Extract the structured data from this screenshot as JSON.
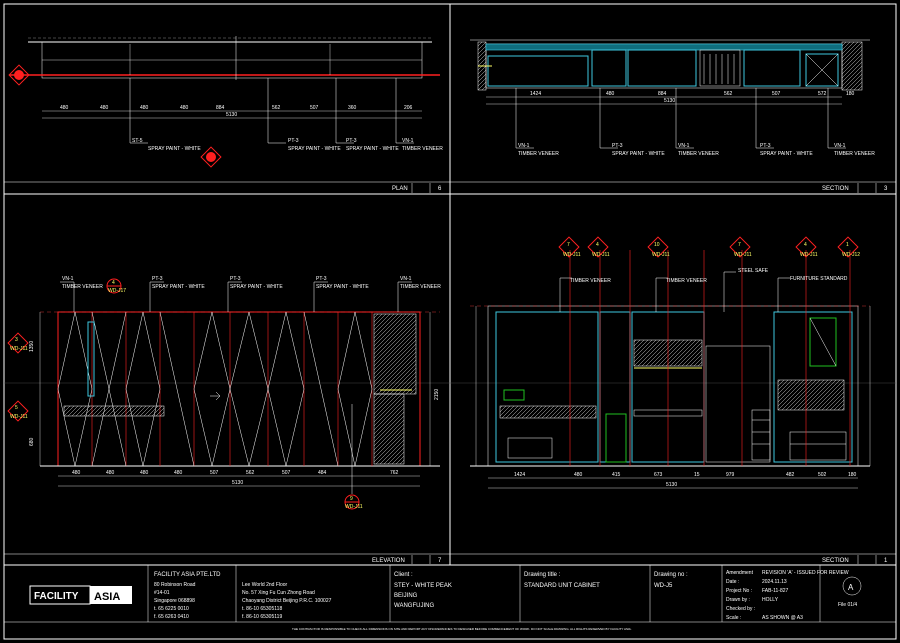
{
  "views": {
    "plan": {
      "label": "PLAN",
      "num": "6"
    },
    "section_top": {
      "label": "SECTION",
      "num": "3"
    },
    "elevation": {
      "label": "ELEVATION",
      "num": "7"
    },
    "section_bottom": {
      "label": "SECTION",
      "num": "1"
    }
  },
  "plan": {
    "dims": [
      "480",
      "480",
      "480",
      "480",
      "884",
      "562",
      "507",
      "360",
      "206"
    ],
    "total": "5130",
    "tags": [
      "ST-5",
      "PT-3",
      "PT-3",
      "VN-1"
    ],
    "notes": [
      "SPRAY PAINT - WHITE",
      "SPRAY PAINT - WHITE",
      "SPRAY PAINT - WHITE",
      "TIMBER VENEER"
    ]
  },
  "section_top": {
    "dims": [
      "1424",
      "480",
      "884",
      "562",
      "507",
      "572",
      "180"
    ],
    "total": "5130",
    "tags": [
      "VN-1",
      "PT-3",
      "VN-1",
      "PT-3",
      "VN-1"
    ],
    "notes": [
      "TIMBER VENEER",
      "SPRAY PAINT - WHITE",
      "TIMBER VENEER",
      "SPRAY PAINT - WHITE",
      "TIMBER VENEER"
    ]
  },
  "elevation": {
    "dims": [
      "480",
      "480",
      "480",
      "480",
      "507",
      "562",
      "507",
      "484",
      "762"
    ],
    "total": "5130",
    "vdims": [
      "1350",
      "2150",
      "680"
    ],
    "tags": [
      "VN-1",
      "PT-3",
      "PT-3",
      "PT-3",
      "VN-1"
    ],
    "notes": [
      "TIMBER VENEER",
      "SPRAY PAINT - WHITE",
      "SPRAY PAINT - WHITE",
      "SPRAY PAINT - WHITE",
      "TIMBER VENEER"
    ],
    "markers": [
      {
        "num": "4",
        "ref": "WD-J17"
      },
      {
        "num": "3",
        "ref": "WD-J11"
      },
      {
        "num": "5",
        "ref": "WD-J11"
      },
      {
        "num": "9",
        "ref": "WD-J11"
      }
    ]
  },
  "section_bottom": {
    "dims": [
      "1424",
      "480",
      "415",
      "673",
      "15",
      "979",
      "482",
      "502",
      "180"
    ],
    "total": "5130",
    "notes": [
      "STEEL SAFE",
      "FURNITURE STANDARD",
      "TIMBER VENEER",
      "TIMBER VENEER"
    ],
    "markers": [
      {
        "num": "7",
        "ref": "WD-J11"
      },
      {
        "num": "4",
        "ref": "WD-J11"
      },
      {
        "num": "10",
        "ref": "WD-J11"
      },
      {
        "num": "7",
        "ref": "WD-J11"
      },
      {
        "num": "4",
        "ref": "WD-J11"
      },
      {
        "num": "1",
        "ref": "WD-J12"
      }
    ]
  },
  "title_block": {
    "logo_a": "FACILITY",
    "logo_b": "ASIA",
    "company": "FACILITY ASIA PTE.LTD",
    "address1": [
      "80 Robinson Road",
      "#14-01",
      "Singapore 068898",
      "t. 65 6225 0010",
      "f. 65 6263 0410"
    ],
    "address2": [
      "Lee World 2nd Floor",
      "No. 57 Xing Fu Cun Zhong Road",
      "Chaoyang District Beijing P.R.C. 100027",
      "t. 86-10 65305118",
      "f. 86-10 65305119"
    ],
    "client_label": "Client :",
    "client": [
      "STEY - WHITE PEAK",
      "BEIJING",
      "WANGFUJING"
    ],
    "title_label": "Drawing title :",
    "title": "STANDARD UNIT CABINET",
    "no_label": "Drawing no :",
    "no": "WD-J5",
    "fields": [
      {
        "label": "Amendment",
        "value": "REVISION 'A' - ISSUED FOR REVIEW"
      },
      {
        "label": "Date :",
        "value": "2024.11.13"
      },
      {
        "label": "Project No :",
        "value": "FAB-11-827"
      },
      {
        "label": "Drawn by :",
        "value": "HOLLY"
      },
      {
        "label": "Checked by :",
        "value": ""
      },
      {
        "label": "Scale :",
        "value": "AS SHOWN @ A3"
      }
    ],
    "rev": "A",
    "sheet": "File 01/4",
    "footer": "THE CONTRACTOR IS RESPONSIBLE TO CHECK ALL DIMENSIONS ON SITE AND REPORT ANY DISCREPANCIES TO DESIGNER BEFORE COMMENCEMENT OF WORK. DO NOT SCALE DRAWING. ALL RIGHTS RESERVED BY FACILITY ASIA."
  }
}
